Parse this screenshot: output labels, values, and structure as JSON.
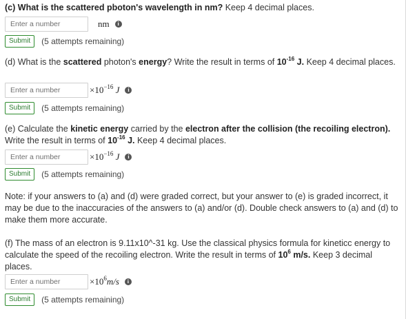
{
  "part_c": {
    "label": "(c)",
    "bold_text": "What is the scattered pboton's wavelength in nm?",
    "rest": " Keep 4 decimal places.",
    "input_placeholder": "Enter a number",
    "unit": "nm",
    "submit_label": "Submit",
    "attempts": "(5 attempts remaining)"
  },
  "part_d": {
    "t1": "(d) What is the ",
    "b1": "scattered",
    "t2": " photon's ",
    "b2": "energy",
    "t3": "? Write the result in terms of ",
    "b3_base": "10",
    "b3_exp": "-16",
    "b3_unit": " J.",
    "t4": " Keep 4 decimal places.",
    "input_placeholder": "Enter a number",
    "unit_times": "×10",
    "unit_exp": "−16",
    "unit_sym": "J",
    "submit_label": "Submit",
    "attempts": "(5 attempts remaining)"
  },
  "part_e": {
    "t1": "(e) Calculate the ",
    "b1": "kinetic energy",
    "t2": " carried by the ",
    "b2": "electron after the collision (the recoiling electron).",
    "t3": " Write the result in terms of ",
    "b3_base": "10",
    "b3_exp": "-16",
    "b3_unit": " J.",
    "t4": " Keep 4 decimal places.",
    "input_placeholder": "Enter a number",
    "unit_times": "×10",
    "unit_exp": "−16",
    "unit_sym": "J",
    "submit_label": "Submit",
    "attempts": "(5 attempts remaining)"
  },
  "note": {
    "text": "Note: if your answers  to (a) and (d) were graded correct, but your answer to (e) is graded incorrect, it may be due to the inaccuracies of the answers to (a) and/or (d). Double check answers  to (a) and (d) to make them more accurate."
  },
  "part_f": {
    "t1": "(f) The mass of an electron is 9.11x10^-31 kg. Use the classical physics formula for kineticc energy to calculate the speed of the recoiling electron. Write the result in terms of ",
    "b_base": "10",
    "b_exp": "6",
    "b_unit": " m/s.",
    "t2": " Keep 3 decimal places.",
    "input_placeholder": "Enter a number",
    "unit_times": "×10",
    "unit_exp": "6",
    "unit_sym": "m/s",
    "submit_label": "Submit",
    "attempts": "(5 attempts remaining)"
  },
  "icons": {
    "info": "info-icon",
    "info_glyph": "i"
  }
}
